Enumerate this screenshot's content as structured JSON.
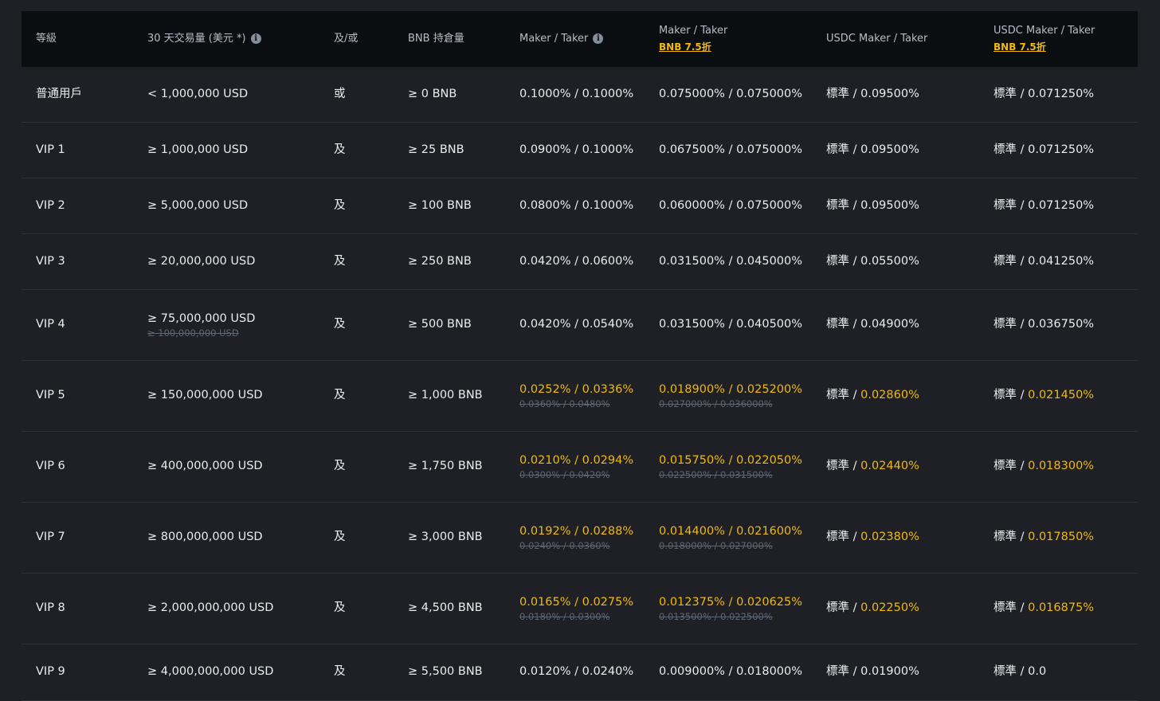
{
  "headers": {
    "tier": "等級",
    "volume": "30 天交易量 (美元 *)",
    "andor": "及/或",
    "bnb_balance": "BNB 持倉量",
    "maker_taker": "Maker / Taker",
    "maker_taker_bnb": "Maker / Taker",
    "maker_taker_bnb_promo": "BNB 7.5折",
    "usdc": "USDC Maker / Taker",
    "usdc_bnb": "USDC Maker / Taker",
    "usdc_bnb_promo": "BNB 7.5折"
  },
  "rows": [
    {
      "tier": "普通用戶",
      "volume": "< 1,000,000 USD",
      "volume_old": "",
      "andor": "或",
      "bnb": "≥ 0 BNB",
      "mt": "0.1000% / 0.1000%",
      "mt_old": "",
      "mtb": "0.075000% / 0.075000%",
      "mtb_old": "",
      "usdc_std": "標準 / ",
      "usdc_val": "0.09500%",
      "usdcb_std": "標準 / ",
      "usdcb_val": "0.071250%",
      "highlight": false
    },
    {
      "tier": "VIP 1",
      "volume": "≥ 1,000,000 USD",
      "volume_old": "",
      "andor": "及",
      "bnb": "≥ 25 BNB",
      "mt": "0.0900% / 0.1000%",
      "mt_old": "",
      "mtb": "0.067500% / 0.075000%",
      "mtb_old": "",
      "usdc_std": "標準 / ",
      "usdc_val": "0.09500%",
      "usdcb_std": "標準 / ",
      "usdcb_val": "0.071250%",
      "highlight": false
    },
    {
      "tier": "VIP 2",
      "volume": "≥ 5,000,000 USD",
      "volume_old": "",
      "andor": "及",
      "bnb": "≥ 100 BNB",
      "mt": "0.0800% / 0.1000%",
      "mt_old": "",
      "mtb": "0.060000% / 0.075000%",
      "mtb_old": "",
      "usdc_std": "標準 / ",
      "usdc_val": "0.09500%",
      "usdcb_std": "標準 / ",
      "usdcb_val": "0.071250%",
      "highlight": false
    },
    {
      "tier": "VIP 3",
      "volume": "≥ 20,000,000 USD",
      "volume_old": "",
      "andor": "及",
      "bnb": "≥ 250 BNB",
      "mt": "0.0420% / 0.0600%",
      "mt_old": "",
      "mtb": "0.031500% / 0.045000%",
      "mtb_old": "",
      "usdc_std": "標準 / ",
      "usdc_val": "0.05500%",
      "usdcb_std": "標準 / ",
      "usdcb_val": "0.041250%",
      "highlight": false
    },
    {
      "tier": "VIP 4",
      "volume": "≥ 75,000,000 USD",
      "volume_old": "≥ 100,000,000 USD",
      "andor": "及",
      "bnb": "≥ 500 BNB",
      "mt": "0.0420% / 0.0540%",
      "mt_old": "",
      "mtb": "0.031500% / 0.040500%",
      "mtb_old": "",
      "usdc_std": "標準 / ",
      "usdc_val": "0.04900%",
      "usdcb_std": "標準 / ",
      "usdcb_val": "0.036750%",
      "highlight": false
    },
    {
      "tier": "VIP 5",
      "volume": "≥ 150,000,000 USD",
      "volume_old": "",
      "andor": "及",
      "bnb": "≥ 1,000 BNB",
      "mt": "0.0252% / 0.0336%",
      "mt_old": "0.0360% / 0.0480%",
      "mtb": "0.018900% / 0.025200%",
      "mtb_old": "0.027000% / 0.036000%",
      "usdc_std": "標準 / ",
      "usdc_val": "0.02860%",
      "usdcb_std": "標準 / ",
      "usdcb_val": "0.021450%",
      "highlight": true
    },
    {
      "tier": "VIP 6",
      "volume": "≥ 400,000,000 USD",
      "volume_old": "",
      "andor": "及",
      "bnb": "≥ 1,750 BNB",
      "mt": "0.0210% / 0.0294%",
      "mt_old": "0.0300% / 0.0420%",
      "mtb": "0.015750% / 0.022050%",
      "mtb_old": "0.022500% / 0.031500%",
      "usdc_std": "標準 / ",
      "usdc_val": "0.02440%",
      "usdcb_std": "標準 / ",
      "usdcb_val": "0.018300%",
      "highlight": true
    },
    {
      "tier": "VIP 7",
      "volume": "≥ 800,000,000 USD",
      "volume_old": "",
      "andor": "及",
      "bnb": "≥ 3,000 BNB",
      "mt": "0.0192% / 0.0288%",
      "mt_old": "0.0240% / 0.0360%",
      "mtb": "0.014400% / 0.021600%",
      "mtb_old": "0.018000% / 0.027000%",
      "usdc_std": "標準 / ",
      "usdc_val": "0.02380%",
      "usdcb_std": "標準 / ",
      "usdcb_val": "0.017850%",
      "highlight": true
    },
    {
      "tier": "VIP 8",
      "volume": "≥ 2,000,000,000 USD",
      "volume_old": "",
      "andor": "及",
      "bnb": "≥ 4,500 BNB",
      "mt": "0.0165% / 0.0275%",
      "mt_old": "0.0180% / 0.0300%",
      "mtb": "0.012375% / 0.020625%",
      "mtb_old": "0.013500% / 0.022500%",
      "usdc_std": "標準 / ",
      "usdc_val": "0.02250%",
      "usdcb_std": "標準 / ",
      "usdcb_val": "0.016875%",
      "highlight": true
    },
    {
      "tier": "VIP 9",
      "volume": "≥ 4,000,000,000 USD",
      "volume_old": "",
      "andor": "及",
      "bnb": "≥ 5,500 BNB",
      "mt": "0.0120% / 0.0240%",
      "mt_old": "",
      "mtb": "0.009000% / 0.018000%",
      "mtb_old": "",
      "usdc_std": "標準 / ",
      "usdc_val": "0.01900%",
      "usdcb_std": "標準 / ",
      "usdcb_val": "0.0",
      "highlight": false
    }
  ],
  "colors": {
    "background": "#1e2026",
    "header_bg": "#0b0e11",
    "text": "#eaecef",
    "muted": "#b7bdc6",
    "accent": "#f0b90b",
    "strike": "#5e6673",
    "divider": "#2b3139"
  }
}
